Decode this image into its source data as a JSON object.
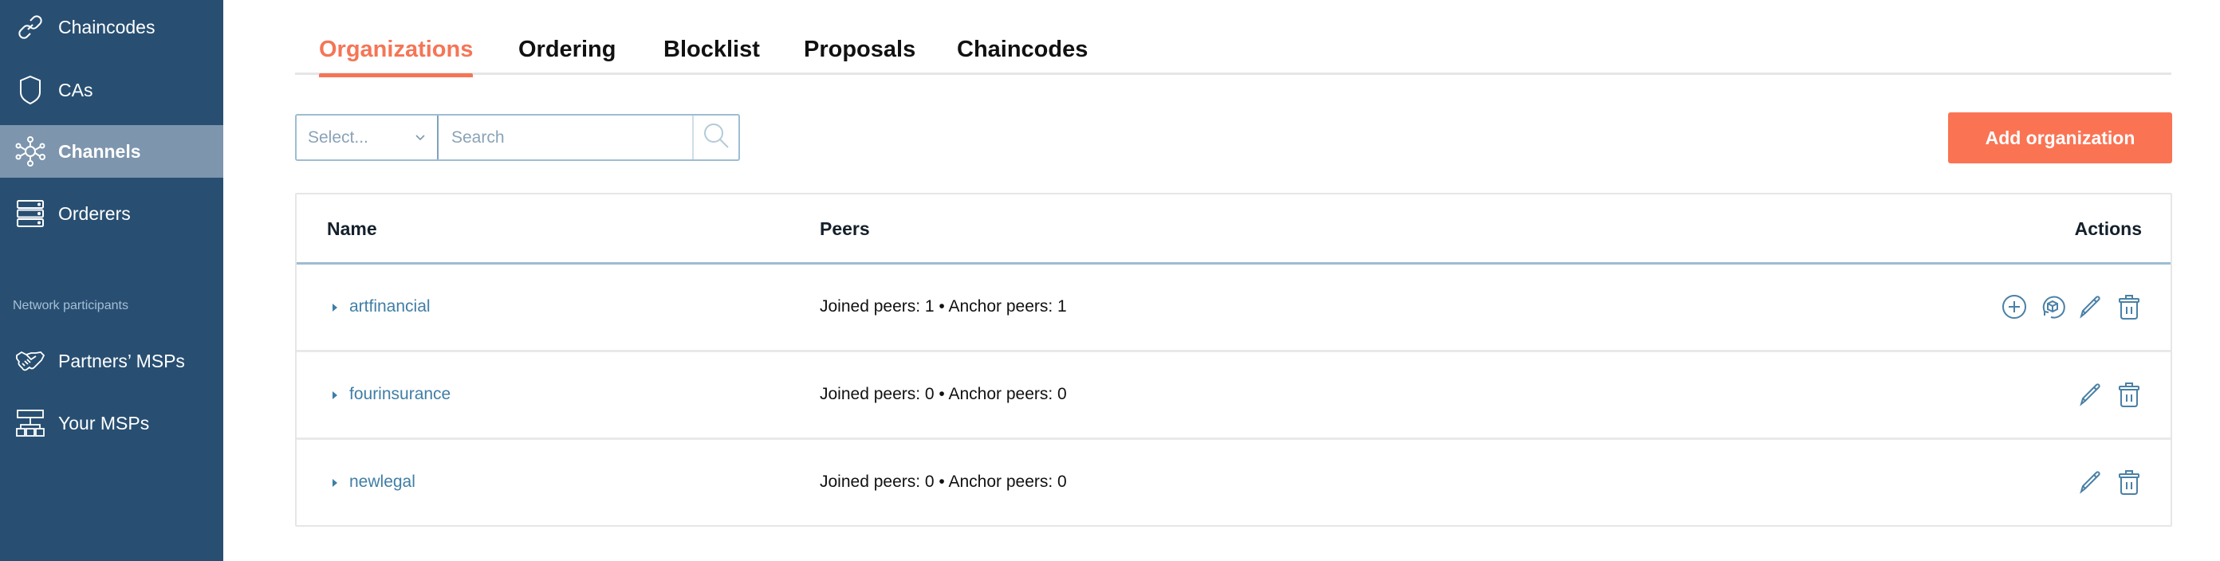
{
  "sidebar": {
    "items": [
      {
        "label": "Chaincodes",
        "icon": "link-icon",
        "active": false
      },
      {
        "label": "CAs",
        "icon": "shield-icon",
        "active": false
      },
      {
        "label": "Channels",
        "icon": "network-icon",
        "active": true
      },
      {
        "label": "Orderers",
        "icon": "server-icon",
        "active": false
      }
    ],
    "section_label": "Network participants",
    "section_items": [
      {
        "label": "Partners’ MSPs",
        "icon": "handshake-icon"
      },
      {
        "label": "Your MSPs",
        "icon": "hierarchy-icon"
      }
    ]
  },
  "tabs": [
    {
      "label": "Organizations",
      "active": true
    },
    {
      "label": "Ordering",
      "active": false
    },
    {
      "label": "Blocklist",
      "active": false
    },
    {
      "label": "Proposals",
      "active": false
    },
    {
      "label": "Chaincodes",
      "active": false
    }
  ],
  "filter": {
    "select_placeholder": "Select...",
    "search_placeholder": "Search",
    "search_value": ""
  },
  "add_button_label": "Add organization",
  "table": {
    "columns": [
      "Name",
      "Peers",
      "Actions"
    ],
    "rows": [
      {
        "name": "artfinancial",
        "peers": "Joined peers: 1 • Anchor peers: 1",
        "actions": [
          "add",
          "sync",
          "edit",
          "delete"
        ]
      },
      {
        "name": "fourinsurance",
        "peers": "Joined peers: 0 • Anchor peers: 0",
        "actions": [
          "edit",
          "delete"
        ]
      },
      {
        "name": "newlegal",
        "peers": "Joined peers: 0 • Anchor peers: 0",
        "actions": [
          "edit",
          "delete"
        ]
      }
    ]
  },
  "colors": {
    "sidebar_bg": "#284f72",
    "sidebar_active": "#7d95ad",
    "accent": "#fa7454",
    "link": "#3f7ea6",
    "icon": "#4a80a6"
  }
}
